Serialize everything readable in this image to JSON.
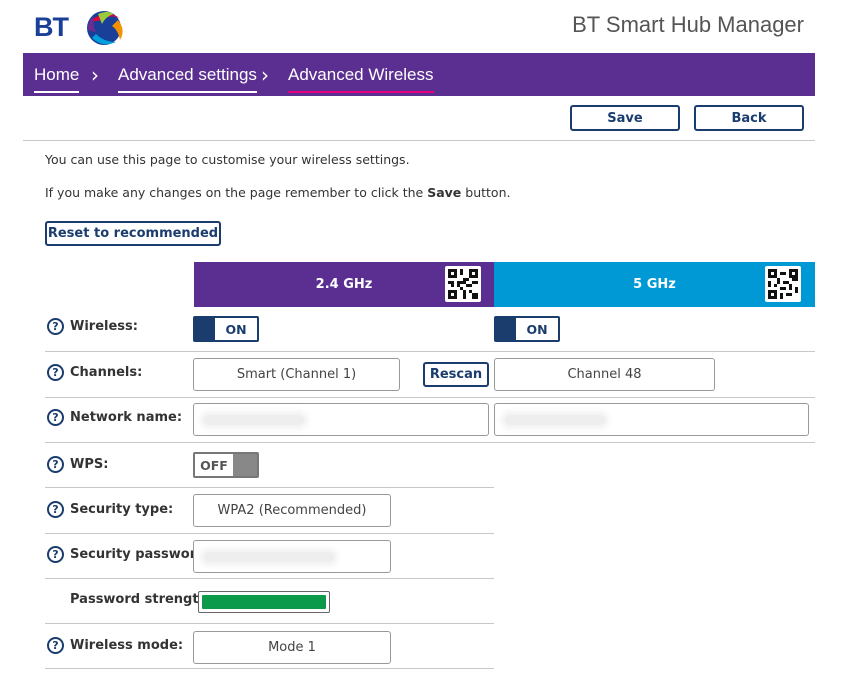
{
  "header": {
    "logo_text": "BT",
    "app_title": "BT Smart Hub Manager"
  },
  "breadcrumb": [
    {
      "label": "Home"
    },
    {
      "label": "Advanced settings"
    },
    {
      "label": "Advanced Wireless"
    }
  ],
  "toolbar": {
    "save_label": "Save",
    "back_label": "Back"
  },
  "intro": {
    "line1": "You can use this page to customise your wireless settings.",
    "line2_before": "If you make any changes on the page remember to click the ",
    "line2_bold": "Save",
    "line2_after": " button."
  },
  "reset_label": "Reset to recommended",
  "bands": {
    "b24": {
      "label": "2.4 GHz",
      "color": "#5b2f91"
    },
    "b5": {
      "label": "5 GHz",
      "color": "#0099d6"
    }
  },
  "rows": {
    "wireless": {
      "label": "Wireless:",
      "b24": "ON",
      "b5": "ON"
    },
    "channels": {
      "label": "Channels:",
      "b24": "Smart (Channel 1)",
      "rescan": "Rescan",
      "b5": "Channel 48"
    },
    "network_name": {
      "label": "Network name:"
    },
    "wps": {
      "label": "WPS:",
      "value": "OFF"
    },
    "security_type": {
      "label": "Security type:",
      "value": "WPA2 (Recommended)"
    },
    "security_password": {
      "label": "Security password:"
    },
    "password_strength": {
      "label": "Password strength:",
      "level": 1.0
    },
    "wireless_mode": {
      "label": "Wireless mode:",
      "value": "Mode 1"
    }
  },
  "help_glyph": "?",
  "icons": {
    "help": "question-circle-icon",
    "qr": "qr-code-icon",
    "chevron": "chevron-right-icon"
  },
  "colors": {
    "brand_purple": "#5b2f91",
    "brand_blue": "#0099d6",
    "navy": "#1a3d6e",
    "accent_pink": "#e6007e",
    "strength_green": "#0a9a4a"
  }
}
